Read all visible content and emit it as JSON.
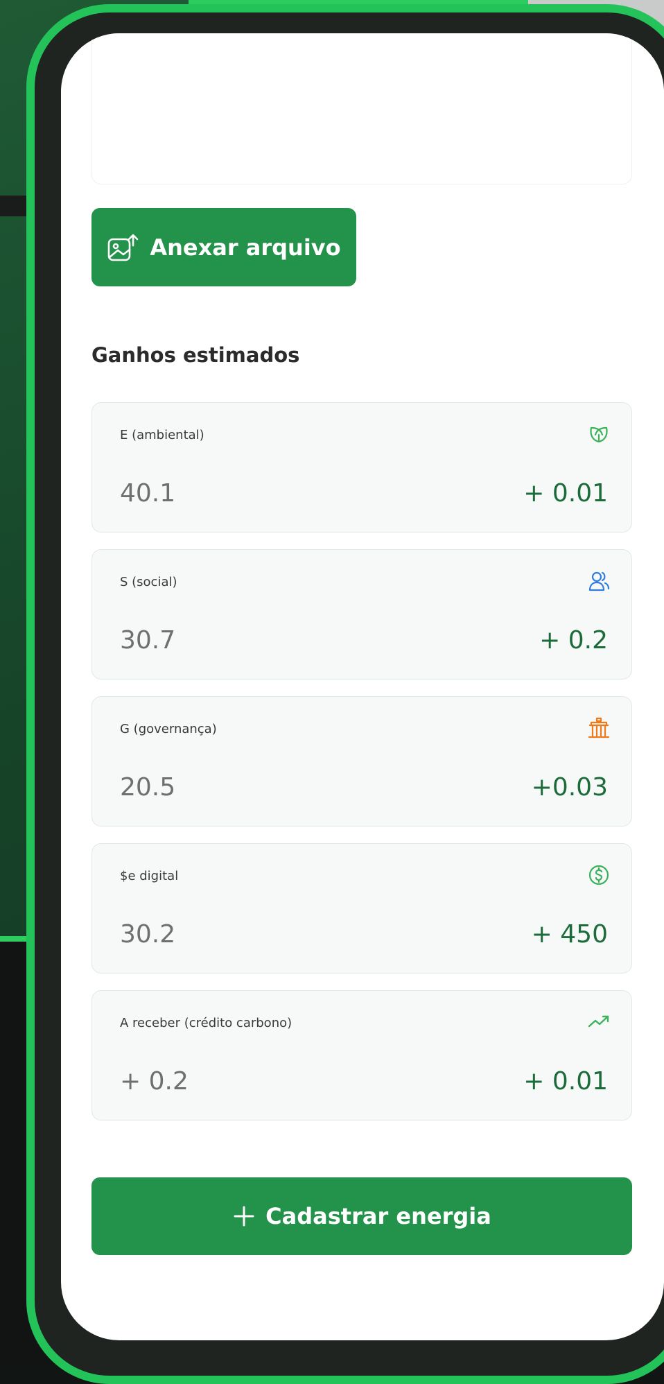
{
  "attach_button": {
    "label": "Anexar arquivo",
    "icon": "image-upload-icon"
  },
  "section": {
    "title": "Ganhos estimados"
  },
  "cards": [
    {
      "label": "E (ambiental)",
      "value": "40.1",
      "gain": "+ 0.01",
      "icon": "leaf-icon",
      "icon_color": "#3cb15a"
    },
    {
      "label": "S (social)",
      "value": "30.7",
      "gain": "+ 0.2",
      "icon": "users-icon",
      "icon_color": "#2f7de1"
    },
    {
      "label": "G (governança)",
      "value": "20.5",
      "gain": "+0.03",
      "icon": "government-building-icon",
      "icon_color": "#f07a1a"
    },
    {
      "label": "$e digital",
      "value": "30.2",
      "gain": "+ 450",
      "icon": "dollar-circle-icon",
      "icon_color": "#3cb15a"
    },
    {
      "label": "A receber (crédito carbono)",
      "value": "+ 0.2",
      "gain": "+ 0.01",
      "icon": "trending-up-icon",
      "icon_color": "#3cb15a"
    }
  ],
  "submit_button": {
    "label": "Cadastrar energia",
    "icon": "plus-icon"
  },
  "colors": {
    "primary": "#23924a",
    "frame": "#23c35a",
    "gain_text": "#1c6b3a"
  }
}
